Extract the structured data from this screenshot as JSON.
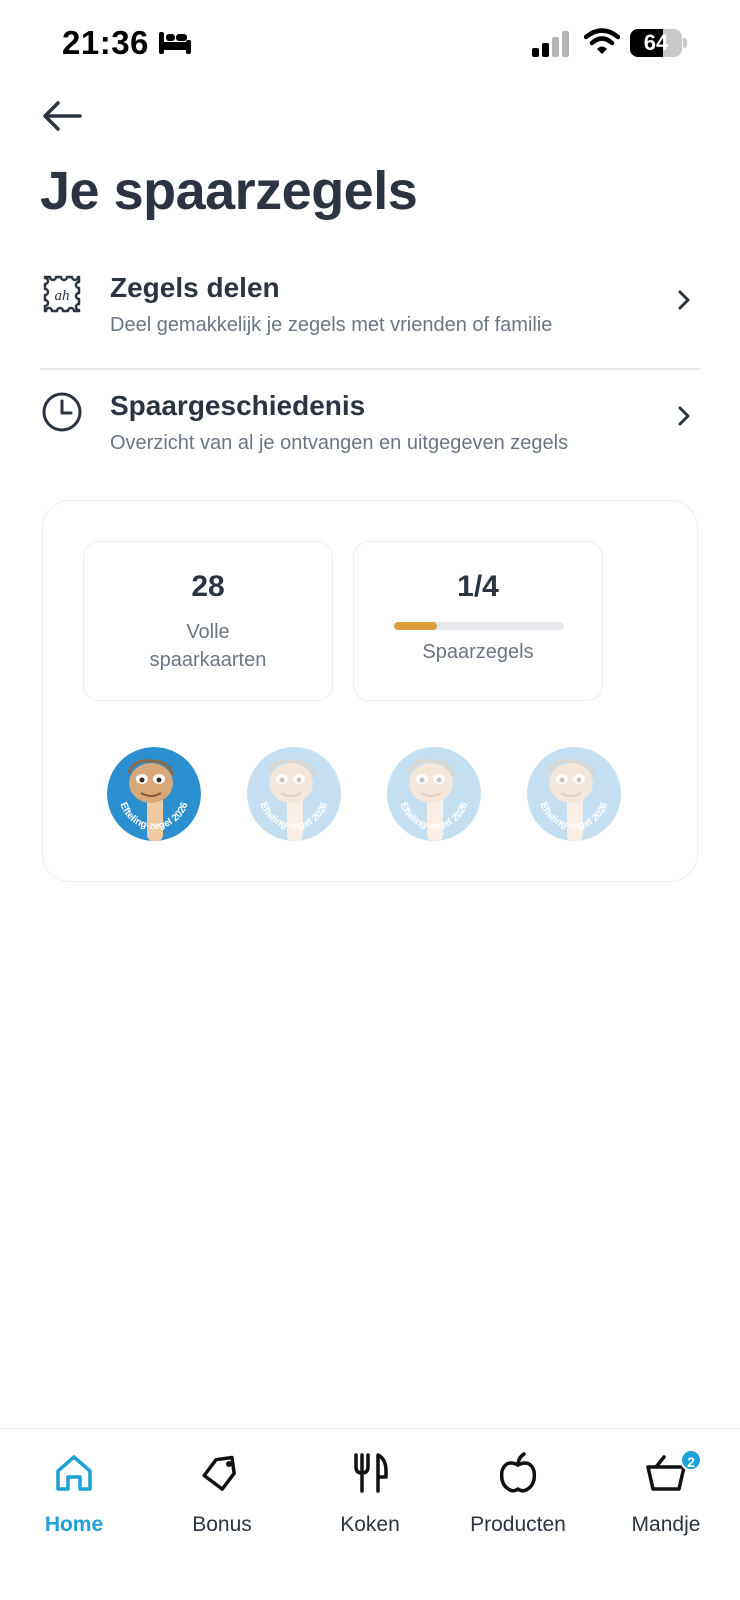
{
  "status_bar": {
    "time": "21:36",
    "battery": "64",
    "battery_level": 0.64
  },
  "page": {
    "title": "Je spaarzegels"
  },
  "menu": [
    {
      "title": "Zegels delen",
      "subtitle": "Deel gemakkelijk je zegels met vrienden of familie",
      "icon": "share-stamp-icon"
    },
    {
      "title": "Spaargeschiedenis",
      "subtitle": "Overzicht van al je ontvangen en uitgegeven zegels",
      "icon": "clock-icon"
    }
  ],
  "card": {
    "full_cards_value": "28",
    "full_cards_label_1": "Volle",
    "full_cards_label_2": "spaarkaarten",
    "stamps_value": "1/4",
    "stamps_label": "Spaarzegels",
    "stamps_progress": 0.25,
    "stamp_text": "Efteling-zegel 2026",
    "collected": 1,
    "total": 4
  },
  "nav": {
    "items": [
      {
        "label": "Home",
        "icon": "home-icon"
      },
      {
        "label": "Bonus",
        "icon": "tag-icon"
      },
      {
        "label": "Koken",
        "icon": "cutlery-icon"
      },
      {
        "label": "Producten",
        "icon": "apple-icon"
      },
      {
        "label": "Mandje",
        "icon": "basket-icon"
      }
    ],
    "active": "Home",
    "basket_badge": "2"
  },
  "colors": {
    "accent": "#1ea0d8",
    "progress": "#d8a03c",
    "text": "#2b3440",
    "muted": "#6b7683"
  }
}
